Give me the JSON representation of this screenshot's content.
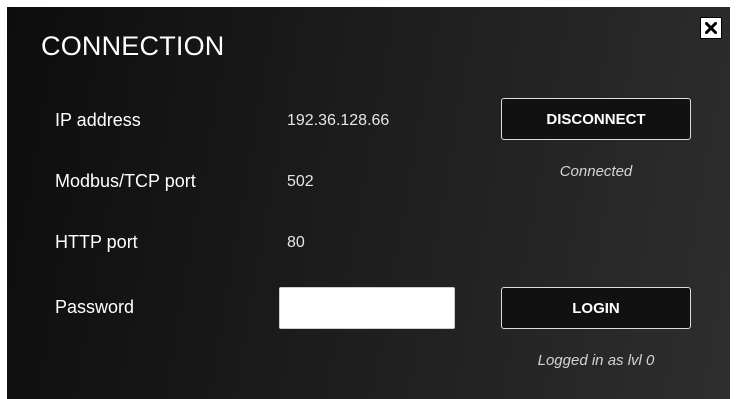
{
  "dialog": {
    "title": "CONNECTION",
    "close_icon": "close-icon"
  },
  "fields": {
    "ip_label": "IP address",
    "ip_value": "192.36.128.66",
    "modbus_label": "Modbus/TCP port",
    "modbus_value": "502",
    "http_label": "HTTP port",
    "http_value": "80",
    "password_label": "Password",
    "password_value": "",
    "password_placeholder": ""
  },
  "actions": {
    "disconnect_label": "DISCONNECT",
    "connection_status": "Connected",
    "login_label": "LOGIN",
    "login_status": "Logged in as lvl 0"
  },
  "colors": {
    "background": "#1a1a1a",
    "text": "#ffffff",
    "button_border": "#dcdcdc"
  }
}
